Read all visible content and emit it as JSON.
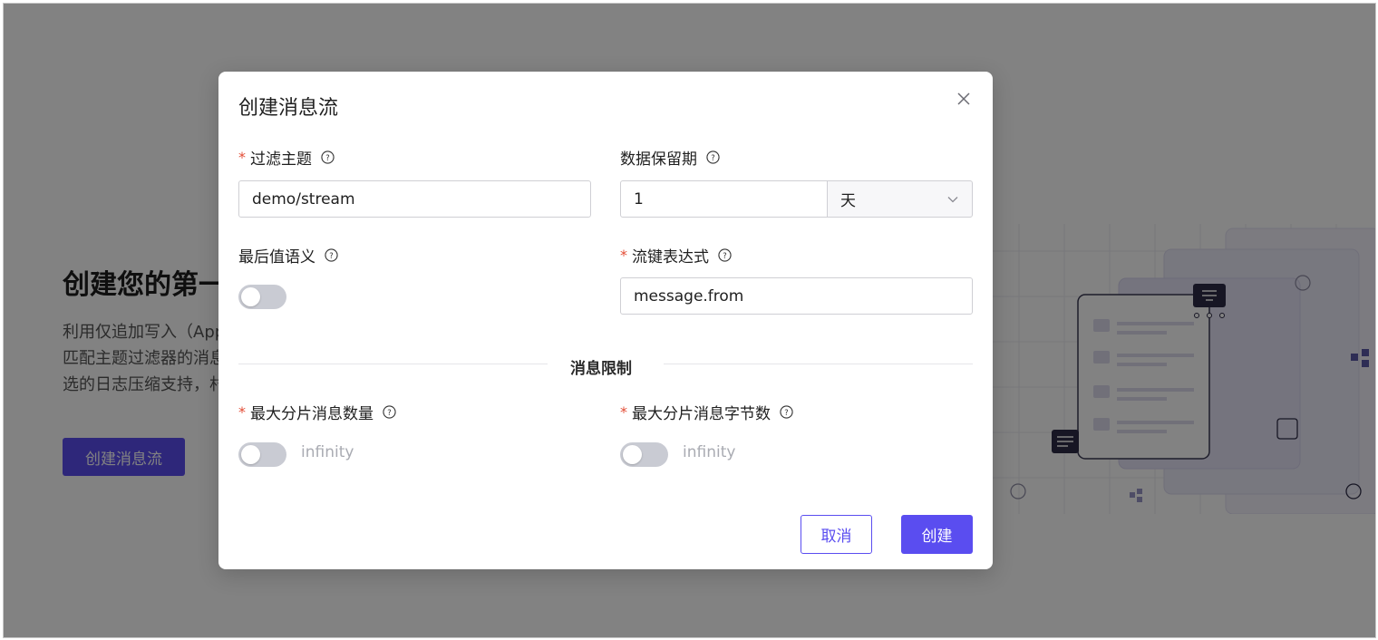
{
  "background": {
    "title": "创建您的第一",
    "desc_line1": "利用仅追加写入（App",
    "desc_line2": "匹配主题过滤器的消息",
    "desc_line3": "选的日志压缩支持，村",
    "button_label": "创建消息流"
  },
  "modal": {
    "title": "创建消息流",
    "filter_topic": {
      "label": "过滤主题",
      "value": "demo/stream"
    },
    "retention": {
      "label": "数据保留期",
      "value": "1",
      "unit": "天"
    },
    "last_value": {
      "label": "最后值语义",
      "enabled": false
    },
    "key_expression": {
      "label": "流键表达式",
      "value": "message.from"
    },
    "section_title": "消息限制",
    "max_shard_messages": {
      "label": "最大分片消息数量",
      "toggle_text": "infinity",
      "enabled": false
    },
    "max_shard_bytes": {
      "label": "最大分片消息字节数",
      "toggle_text": "infinity",
      "enabled": false
    },
    "cancel_label": "取消",
    "create_label": "创建"
  },
  "colors": {
    "accent": "#5a4df0",
    "required": "#e34d36",
    "toggle_off": "#c9cbd3"
  }
}
